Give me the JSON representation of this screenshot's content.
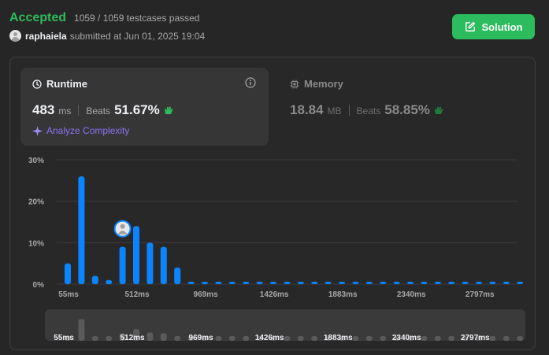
{
  "submission": {
    "status": "Accepted",
    "testcases": "1059 / 1059 testcases passed",
    "username": "raphaiela",
    "submitted_text": "submitted at Jun 01, 2025 19:04"
  },
  "solution_button": {
    "label": "Solution"
  },
  "runtime": {
    "title": "Runtime",
    "value": "483",
    "unit": "ms",
    "beats_label": "Beats",
    "beats_value": "51.67%",
    "analyze_label": "Analyze Complexity"
  },
  "memory": {
    "title": "Memory",
    "value": "18.84",
    "unit": "MB",
    "beats_label": "Beats",
    "beats_value": "58.85%"
  },
  "colors": {
    "accent_green": "#2cbb5d",
    "bar_blue": "#0a84ff",
    "analyze_purple": "#8d73f5"
  },
  "chart_data": {
    "type": "bar",
    "ylabels": [
      "30%",
      "20%",
      "10%",
      "0%"
    ],
    "ylim": [
      0,
      30
    ],
    "xlabels": [
      "55ms",
      "512ms",
      "969ms",
      "1426ms",
      "1883ms",
      "2340ms",
      "2797ms"
    ],
    "values": [
      5,
      26,
      2,
      1,
      9,
      14,
      10,
      9,
      4,
      0.6,
      0.6,
      0.6,
      0.6,
      0.6,
      0.6,
      0.6,
      0.6,
      0.6,
      0.6,
      0.6,
      0.6,
      0.6,
      0.6,
      0.6,
      0.6,
      0.6,
      0.6,
      0.6,
      0.6,
      0.6,
      0.6,
      0.6,
      0.6,
      0.6
    ],
    "user_bar_index": 4,
    "grid": true
  }
}
